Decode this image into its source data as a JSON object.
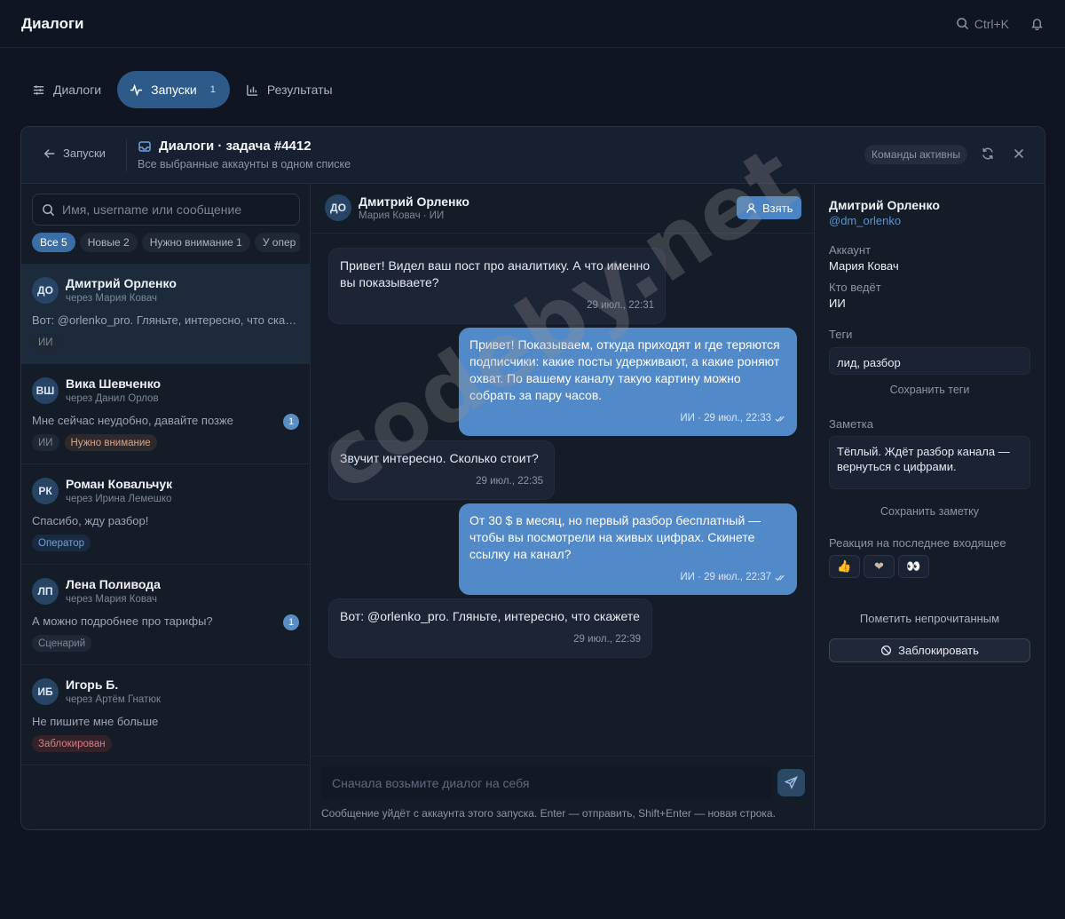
{
  "app": {
    "title": "Диалоги",
    "shortcut": "Ctrl+K"
  },
  "tabs": [
    {
      "label": "Диалоги",
      "icon": "sliders-icon"
    },
    {
      "label": "Запуски",
      "icon": "activity-icon",
      "count": "1",
      "active": true
    },
    {
      "label": "Результаты",
      "icon": "bar-chart-icon"
    }
  ],
  "panel": {
    "back_label": "Запуски",
    "title": "Диалоги · задача #4412",
    "subtitle": "Все выбранные аккаунты в одном списке",
    "commands_badge": "Команды активны"
  },
  "sidebar": {
    "search_placeholder": "Имя, username или сообщение",
    "filters": [
      "Все 5",
      "Новые 2",
      "Нужно внимание 1",
      "У опер"
    ],
    "conversations": [
      {
        "initials": "ДО",
        "name": "Дмитрий Орленко",
        "via": "через Мария Ковач",
        "message": "Вот: @orlenko_pro. Гляньте, интересно, что скажете",
        "unread": "",
        "tags": [
          "ИИ"
        ]
      },
      {
        "initials": "ВШ",
        "name": "Вика Шевченко",
        "via": "через Данил Орлов",
        "message": "Мне сейчас неудобно, давайте позже",
        "unread": "1",
        "tags": [
          "ИИ",
          "Нужно внимание"
        ]
      },
      {
        "initials": "РК",
        "name": "Роман Ковальчук",
        "via": "через Ирина Лемешко",
        "message": "Спасибо, жду разбор!",
        "unread": "",
        "tags": [
          "Оператор"
        ]
      },
      {
        "initials": "ЛП",
        "name": "Лена Поливода",
        "via": "через Мария Ковач",
        "message": "А можно подробнее про тарифы?",
        "unread": "1",
        "tags": [
          "Сценарий"
        ]
      },
      {
        "initials": "ИБ",
        "name": "Игорь Б.",
        "via": "через Артём Гнатюк",
        "message": "Не пишите мне больше",
        "unread": "",
        "tags": [
          "Заблокирован"
        ]
      }
    ]
  },
  "chat": {
    "initials": "ДО",
    "name": "Дмитрий Орленко",
    "sub": "Мария Ковач · ИИ",
    "take_label": "Взять",
    "messages": [
      {
        "dir": "in",
        "text": "Привет! Видел ваш пост про аналитику. А что именно вы показываете?",
        "meta": "29 июл., 22:31"
      },
      {
        "dir": "out",
        "text": "Привет! Показываем, откуда приходят и где теряются подписчики: какие посты удерживают, а какие роняют охват. По вашему каналу такую картину можно собрать за пару часов.",
        "meta": "ИИ · 29 июл., 22:33"
      },
      {
        "dir": "in",
        "text": "Звучит интересно. Сколько стоит?",
        "meta": "29 июл., 22:35"
      },
      {
        "dir": "out",
        "text": "От 30 $ в месяц, но первый разбор бесплатный — чтобы вы посмотрели на живых цифрах. Скинете ссылку на канал?",
        "meta": "ИИ · 29 июл., 22:37"
      },
      {
        "dir": "in",
        "text": "Вот: @orlenko_pro. Гляньте, интересно, что скажете",
        "meta": "29 июл., 22:39"
      }
    ],
    "composer_placeholder": "Сначала возьмите диалог на себя",
    "composer_hint": "Сообщение уйдёт с аккаунта этого запуска. Enter — отправить, Shift+Enter — новая строка."
  },
  "details": {
    "name": "Дмитрий Орленко",
    "username": "@dm_orlenko",
    "account_label": "Аккаунт",
    "account_value": "Мария Ковач",
    "owner_label": "Кто ведёт",
    "owner_value": "ИИ",
    "tags_label": "Теги",
    "tags_value": "лид, разбор",
    "save_tags": "Сохранить теги",
    "note_label": "Заметка",
    "note_value": "Тёплый. Ждёт разбор канала — вернуться с цифрами.",
    "save_note": "Сохранить заметку",
    "reaction_label": "Реакция на последнее входящее",
    "reactions": [
      "👍",
      "❤",
      "👀"
    ],
    "mark_unread": "Пометить непрочитанным",
    "block_label": "Заблокировать"
  },
  "watermark": "codeby.net",
  "colors": {
    "accent": "#4a84c4",
    "outgoing": "#5289c8",
    "background": "#0f1622"
  }
}
